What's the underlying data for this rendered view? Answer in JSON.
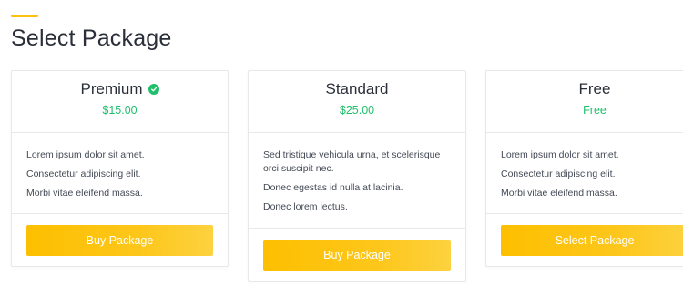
{
  "page": {
    "title": "Select Package"
  },
  "packages": [
    {
      "name": "Premium",
      "price": "$15.00",
      "verified": true,
      "features": [
        "Lorem ipsum dolor sit amet.",
        "Consectetur adipiscing elit.",
        "Morbi vitae eleifend massa."
      ],
      "button_label": "Buy Package"
    },
    {
      "name": "Standard",
      "price": "$25.00",
      "verified": false,
      "features": [
        "Sed tristique vehicula urna, et scelerisque orci suscipit nec.",
        "Donec egestas id nulla at lacinia.",
        "Donec lorem lectus."
      ],
      "button_label": "Buy Package"
    },
    {
      "name": "Free",
      "price": "Free",
      "verified": false,
      "features": [
        "Lorem ipsum dolor sit amet.",
        "Consectetur adipiscing elit.",
        "Morbi vitae eleifend massa."
      ],
      "button_label": "Select Package"
    }
  ],
  "colors": {
    "accent": "#fdc20f",
    "price": "#1fbf6b",
    "button": "#fdbf00",
    "border": "#e6e8ec"
  },
  "icons": {
    "verified": "check-circle-icon"
  }
}
